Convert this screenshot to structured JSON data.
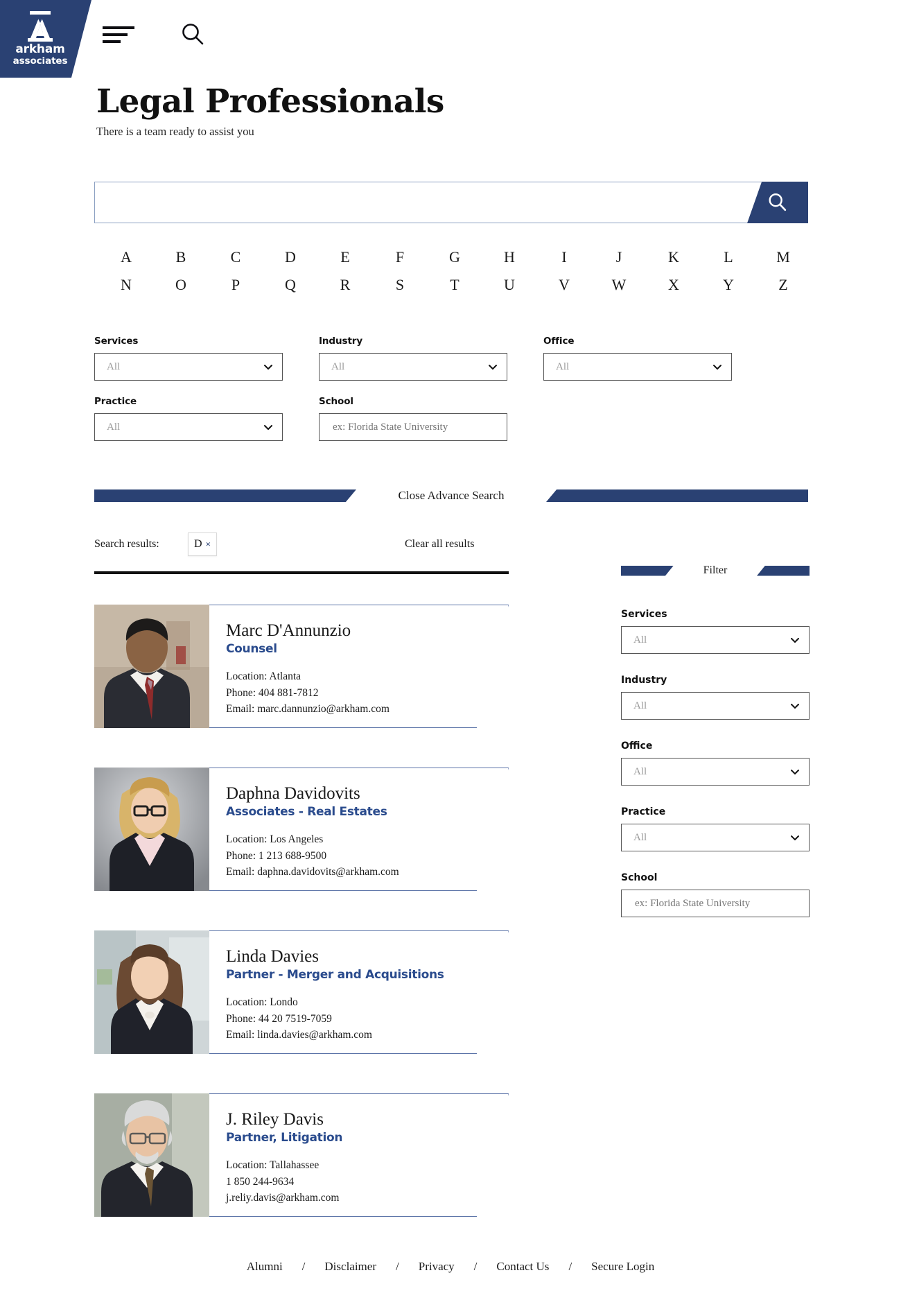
{
  "brand": {
    "name_line1": "arkham",
    "name_line2": "associates",
    "navy": "#2a4173",
    "accent_blue": "#2a4b8d"
  },
  "header": {
    "menu_icon": "hamburger-icon",
    "search_icon": "search-icon"
  },
  "page": {
    "title": "Legal Professionals",
    "subtitle": "There is a team ready to assist you"
  },
  "search": {
    "value": "",
    "placeholder": "",
    "button_icon": "search-icon"
  },
  "alphabet": {
    "row1": [
      "A",
      "B",
      "C",
      "D",
      "E",
      "F",
      "G",
      "H",
      "I",
      "J",
      "K",
      "L",
      "M"
    ],
    "row2": [
      "N",
      "O",
      "P",
      "Q",
      "R",
      "S",
      "T",
      "U",
      "V",
      "W",
      "X",
      "Y",
      "Z"
    ]
  },
  "advanced_filters": {
    "services": {
      "label": "Services",
      "value": "All"
    },
    "industry": {
      "label": "Industry",
      "value": "All"
    },
    "office": {
      "label": "Office",
      "value": "All"
    },
    "practice": {
      "label": "Practice",
      "value": "All"
    },
    "school": {
      "label": "School",
      "value": "",
      "placeholder": "ex: Florida State University"
    },
    "toggle_label": "Close Advance Search"
  },
  "results": {
    "label": "Search results:",
    "chip": {
      "text": "D",
      "remove": "×"
    },
    "clear_label": "Clear all results",
    "people": [
      {
        "name": "Marc D'Annunzio",
        "title": "Counsel",
        "location": "Location: Atlanta",
        "phone": "Phone: 404 881-7812",
        "email": "Email: marc.dannunzio@arkham.com",
        "photo": "male-dark-suit-red-tie"
      },
      {
        "name": "Daphna Davidovits",
        "title": "Associates - Real Estates",
        "location": "Location: Los Angeles",
        "phone": "Phone: 1 213 688-9500",
        "email": "Email: daphna.davidovits@arkham.com",
        "photo": "female-blonde-glasses-black-blazer"
      },
      {
        "name": "Linda Davies",
        "title": "Partner - Merger and Acquisitions",
        "location": "Location: Londo",
        "phone": "Phone: 44 20 7519-7059",
        "email": "Email: linda.davies@arkham.com",
        "photo": "female-brunette-black-blazer"
      },
      {
        "name": "J. Riley Davis",
        "title": "Partner, Litigation",
        "location": "Location: Tallahassee",
        "phone": "1 850 244-9634",
        "email": "j.reliy.davis@arkham.com",
        "photo": "male-grey-hair-glasses-suit"
      }
    ]
  },
  "sidebar": {
    "title": "Filter",
    "services": {
      "label": "Services",
      "value": "All"
    },
    "industry": {
      "label": "Industry",
      "value": "All"
    },
    "office": {
      "label": "Office",
      "value": "All"
    },
    "practice": {
      "label": "Practice",
      "value": "All"
    },
    "school": {
      "label": "School",
      "value": "",
      "placeholder": "ex: Florida State University"
    }
  },
  "footer": {
    "links": [
      "Alumni",
      "Disclaimer",
      "Privacy",
      "Contact Us",
      "Secure Login"
    ],
    "separator": "/"
  }
}
